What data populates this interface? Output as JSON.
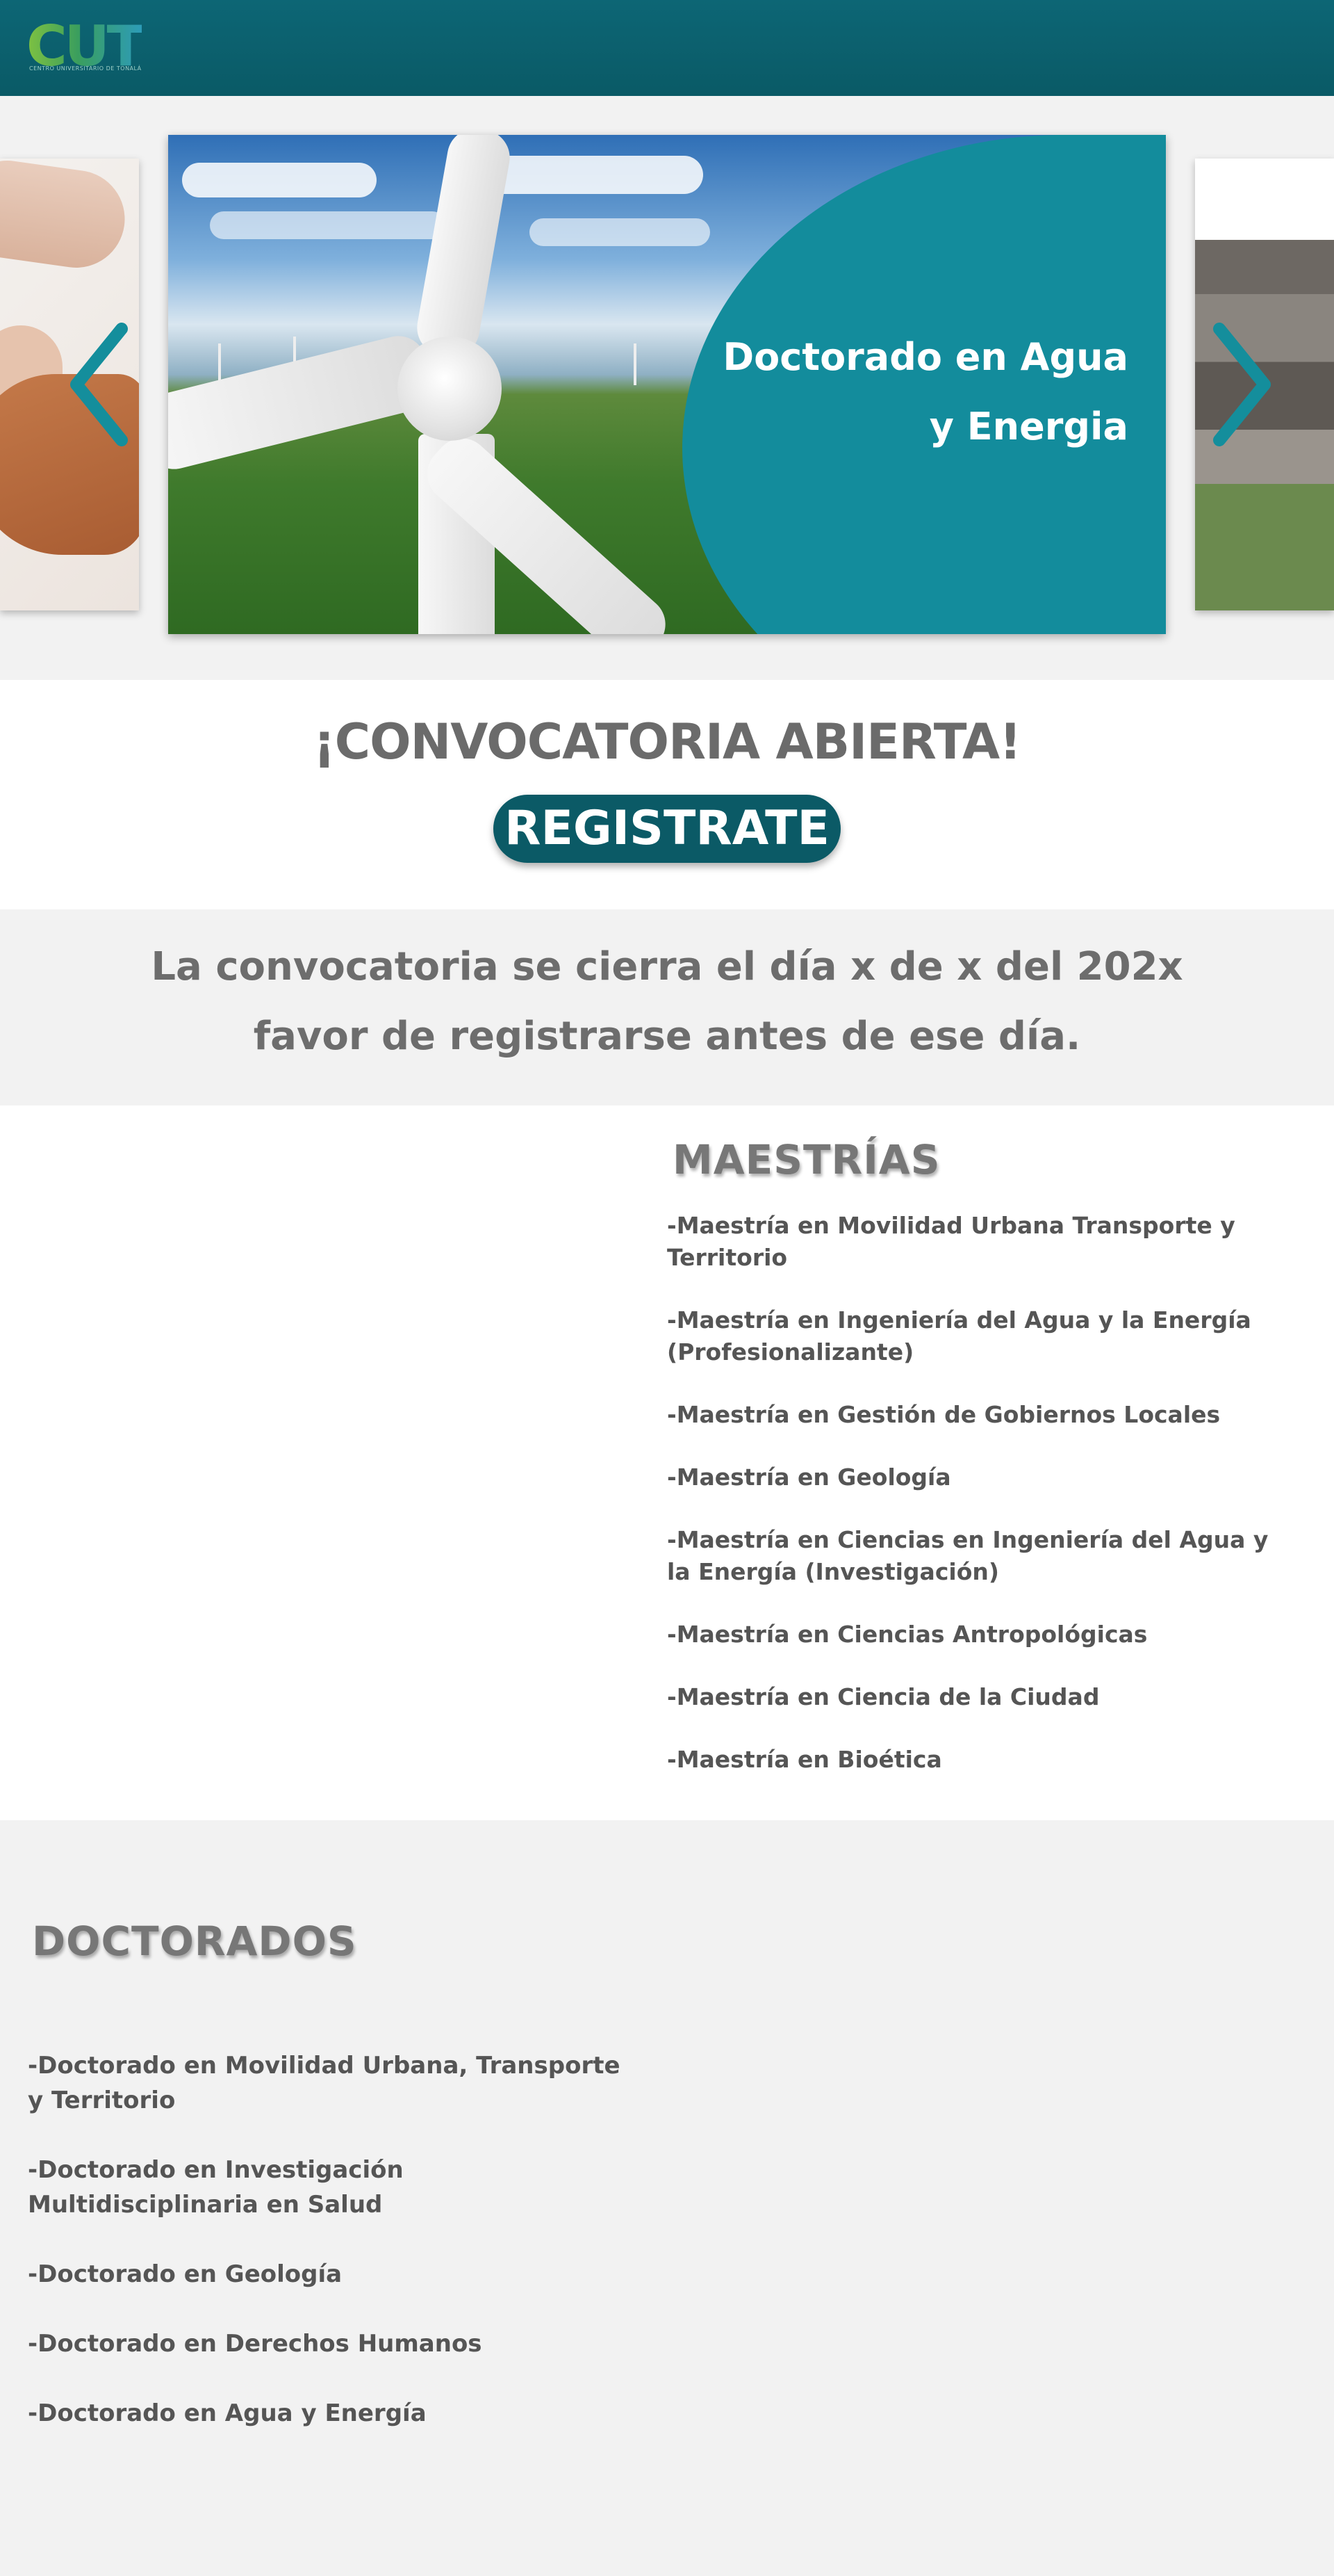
{
  "header": {
    "logo_text": "CUT",
    "logo_subtext": "CENTRO UNIVERSITARIO DE TONALÁ",
    "background": "#0b5f6b"
  },
  "carousel": {
    "main_slide_title": "Doctorado en Agua y Energia",
    "prev_icon": "chevron-left-icon",
    "next_icon": "chevron-right-icon",
    "accent": "#138c9c"
  },
  "convocatoria": {
    "title": "¡CONVOCATORIA ABIERTA!",
    "register_label": "REGISTRATE",
    "button_color": "#0b5a66"
  },
  "deadline": {
    "line1": "La convocatoria se cierra el día x de x del 202x",
    "line2": "favor de registrarse antes de ese día."
  },
  "maestrias": {
    "heading": "MAESTRÍAS",
    "items": [
      "-Maestría en Movilidad Urbana Transporte y Territorio",
      "-Maestría en Ingeniería del Agua y la Energía (Profesionalizante)",
      "-Maestría en Gestión de Gobiernos Locales",
      "-Maestría en Geología",
      "-Maestría en Ciencias en Ingeniería del Agua y la Energía (Investigación)",
      "-Maestría en Ciencias Antropológicas",
      "-Maestría en Ciencia de la Ciudad",
      "-Maestría en Bioética"
    ]
  },
  "doctorados": {
    "heading": "DOCTORADOS",
    "items": [
      "-Doctorado en Movilidad Urbana, Transporte y Territorio",
      "-Doctorado en Investigación Multidisciplinaria en Salud",
      "-Doctorado en Geología",
      "-Doctorado en Derechos Humanos",
      "-Doctorado en Agua y Energía"
    ]
  }
}
